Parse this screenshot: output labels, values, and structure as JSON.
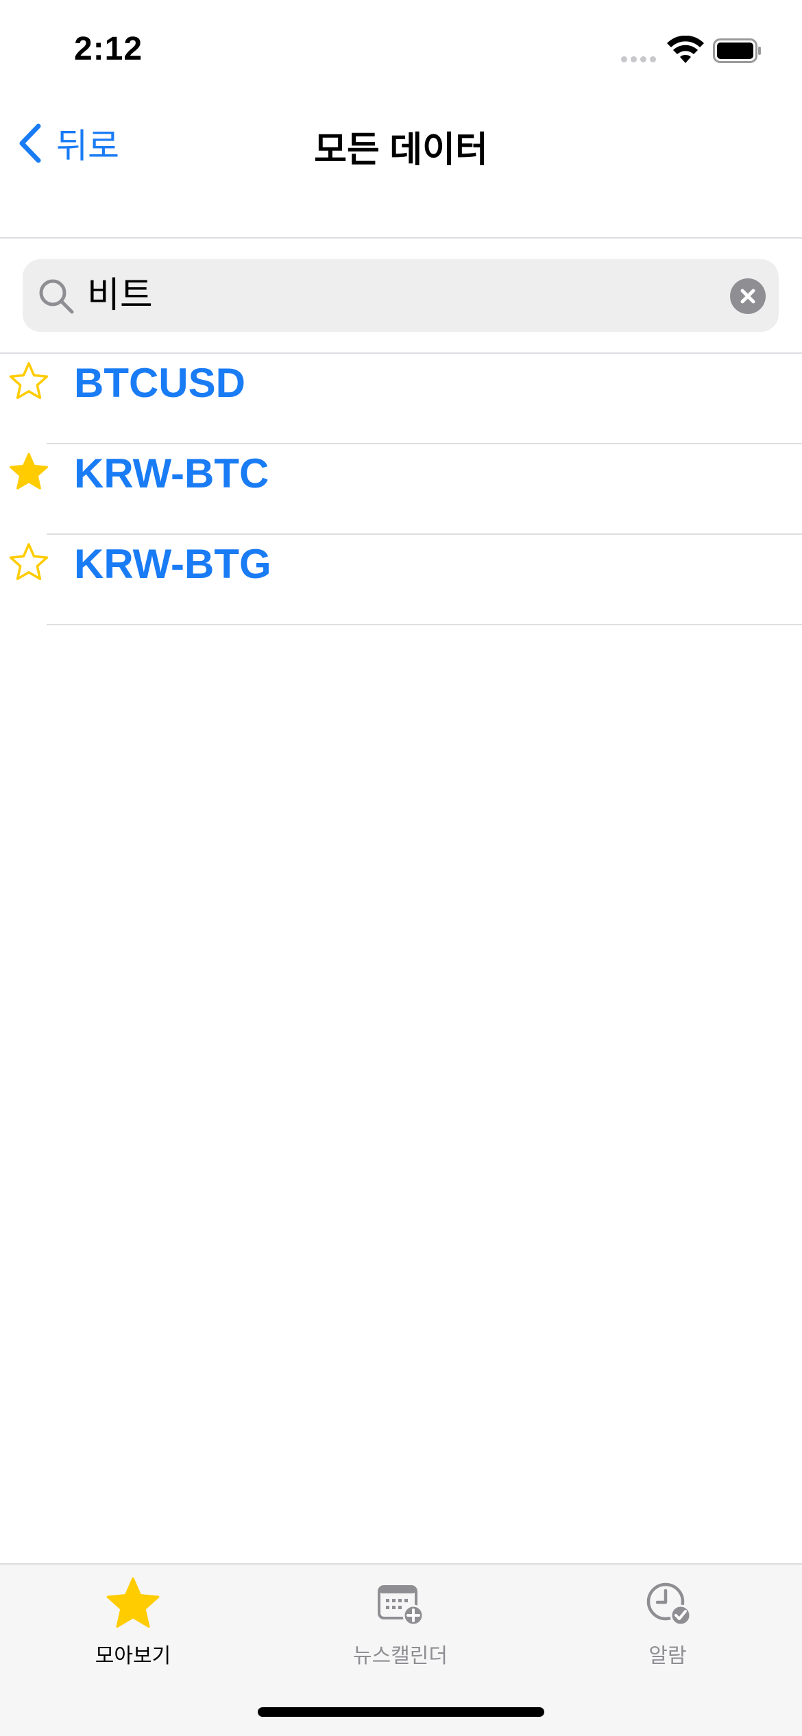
{
  "status_bar": {
    "time": "2:12"
  },
  "nav": {
    "back_label": "뒤로",
    "title": "모든 데이터"
  },
  "search": {
    "value": "비트"
  },
  "results": [
    {
      "symbol": "BTCUSD",
      "favorited": false
    },
    {
      "symbol": "KRW-BTC",
      "favorited": true
    },
    {
      "symbol": "KRW-BTG",
      "favorited": false
    }
  ],
  "tabs": [
    {
      "label": "모아보기",
      "icon": "star-icon",
      "active": true
    },
    {
      "label": "뉴스캘린더",
      "icon": "calendar-add-icon",
      "active": false
    },
    {
      "label": "알람",
      "icon": "clock-check-icon",
      "active": false
    }
  ],
  "colors": {
    "accent": "#1a7cf5",
    "star": "#ffcc00",
    "inactive": "#8e8e93"
  }
}
